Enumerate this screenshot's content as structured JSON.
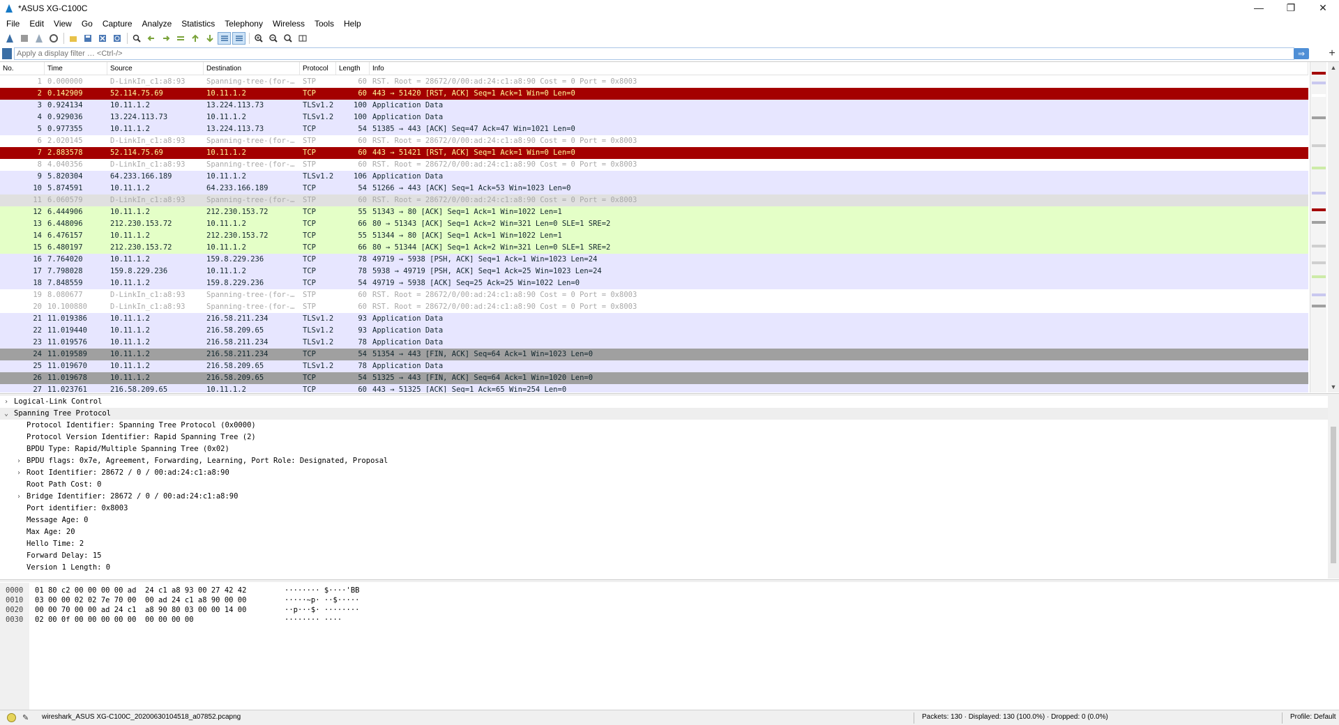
{
  "window": {
    "title": "*ASUS XG-C100C",
    "controls": {
      "minimize": "—",
      "maximize": "❐",
      "close": "✕"
    }
  },
  "menu": [
    "File",
    "Edit",
    "View",
    "Go",
    "Capture",
    "Analyze",
    "Statistics",
    "Telephony",
    "Wireless",
    "Tools",
    "Help"
  ],
  "filter": {
    "placeholder": "Apply a display filter … <Ctrl-/>",
    "value": ""
  },
  "columns": [
    "No.",
    "Time",
    "Source",
    "Destination",
    "Protocol",
    "Length",
    "Info"
  ],
  "packets": [
    {
      "no": "1",
      "time": "0.000000",
      "src": "D-LinkIn_c1:a8:93",
      "dst": "Spanning-tree-(for-…",
      "proto": "STP",
      "len": "60",
      "info": "RST. Root = 28672/0/00:ad:24:c1:a8:90  Cost = 0  Port = 0x8003",
      "style": "stp"
    },
    {
      "no": "2",
      "time": "0.142909",
      "src": "52.114.75.69",
      "dst": "10.11.1.2",
      "proto": "TCP",
      "len": "60",
      "info": "443 → 51420 [RST, ACK] Seq=1 Ack=1 Win=0 Len=0",
      "style": "rst"
    },
    {
      "no": "3",
      "time": "0.924134",
      "src": "10.11.1.2",
      "dst": "13.224.113.73",
      "proto": "TLSv1.2",
      "len": "100",
      "info": "Application Data",
      "style": "tls"
    },
    {
      "no": "4",
      "time": "0.929036",
      "src": "13.224.113.73",
      "dst": "10.11.1.2",
      "proto": "TLSv1.2",
      "len": "100",
      "info": "Application Data",
      "style": "tls"
    },
    {
      "no": "5",
      "time": "0.977355",
      "src": "10.11.1.2",
      "dst": "13.224.113.73",
      "proto": "TCP",
      "len": "54",
      "info": "51385 → 443 [ACK] Seq=47 Ack=47 Win=1021 Len=0",
      "style": "tcp"
    },
    {
      "no": "6",
      "time": "2.020145",
      "src": "D-LinkIn_c1:a8:93",
      "dst": "Spanning-tree-(for-…",
      "proto": "STP",
      "len": "60",
      "info": "RST. Root = 28672/0/00:ad:24:c1:a8:90  Cost = 0  Port = 0x8003",
      "style": "stp"
    },
    {
      "no": "7",
      "time": "2.883578",
      "src": "52.114.75.69",
      "dst": "10.11.1.2",
      "proto": "TCP",
      "len": "60",
      "info": "443 → 51421 [RST, ACK] Seq=1 Ack=1 Win=0 Len=0",
      "style": "rst"
    },
    {
      "no": "8",
      "time": "4.040356",
      "src": "D-LinkIn_c1:a8:93",
      "dst": "Spanning-tree-(for-…",
      "proto": "STP",
      "len": "60",
      "info": "RST. Root = 28672/0/00:ad:24:c1:a8:90  Cost = 0  Port = 0x8003",
      "style": "stp"
    },
    {
      "no": "9",
      "time": "5.820304",
      "src": "64.233.166.189",
      "dst": "10.11.1.2",
      "proto": "TLSv1.2",
      "len": "106",
      "info": "Application Data",
      "style": "tls"
    },
    {
      "no": "10",
      "time": "5.874591",
      "src": "10.11.1.2",
      "dst": "64.233.166.189",
      "proto": "TCP",
      "len": "54",
      "info": "51266 → 443 [ACK] Seq=1 Ack=53 Win=1023 Len=0",
      "style": "tcp"
    },
    {
      "no": "11",
      "time": "6.060579",
      "src": "D-LinkIn_c1:a8:93",
      "dst": "Spanning-tree-(for-…",
      "proto": "STP",
      "len": "60",
      "info": "RST. Root = 28672/0/00:ad:24:c1:a8:90  Cost = 0  Port = 0x8003",
      "style": "gray"
    },
    {
      "no": "12",
      "time": "6.444906",
      "src": "10.11.1.2",
      "dst": "212.230.153.72",
      "proto": "TCP",
      "len": "55",
      "info": "51343 → 80 [ACK] Seq=1 Ack=1 Win=1022 Len=1",
      "style": "green"
    },
    {
      "no": "13",
      "time": "6.448096",
      "src": "212.230.153.72",
      "dst": "10.11.1.2",
      "proto": "TCP",
      "len": "66",
      "info": "80 → 51343 [ACK] Seq=1 Ack=2 Win=321 Len=0 SLE=1 SRE=2",
      "style": "green"
    },
    {
      "no": "14",
      "time": "6.476157",
      "src": "10.11.1.2",
      "dst": "212.230.153.72",
      "proto": "TCP",
      "len": "55",
      "info": "51344 → 80 [ACK] Seq=1 Ack=1 Win=1022 Len=1",
      "style": "green"
    },
    {
      "no": "15",
      "time": "6.480197",
      "src": "212.230.153.72",
      "dst": "10.11.1.2",
      "proto": "TCP",
      "len": "66",
      "info": "80 → 51344 [ACK] Seq=1 Ack=2 Win=321 Len=0 SLE=1 SRE=2",
      "style": "green"
    },
    {
      "no": "16",
      "time": "7.764020",
      "src": "10.11.1.2",
      "dst": "159.8.229.236",
      "proto": "TCP",
      "len": "78",
      "info": "49719 → 5938 [PSH, ACK] Seq=1 Ack=1 Win=1023 Len=24",
      "style": "tcp"
    },
    {
      "no": "17",
      "time": "7.798028",
      "src": "159.8.229.236",
      "dst": "10.11.1.2",
      "proto": "TCP",
      "len": "78",
      "info": "5938 → 49719 [PSH, ACK] Seq=1 Ack=25 Win=1023 Len=24",
      "style": "tcp"
    },
    {
      "no": "18",
      "time": "7.848559",
      "src": "10.11.1.2",
      "dst": "159.8.229.236",
      "proto": "TCP",
      "len": "54",
      "info": "49719 → 5938 [ACK] Seq=25 Ack=25 Win=1022 Len=0",
      "style": "tcp"
    },
    {
      "no": "19",
      "time": "8.080677",
      "src": "D-LinkIn_c1:a8:93",
      "dst": "Spanning-tree-(for-…",
      "proto": "STP",
      "len": "60",
      "info": "RST. Root = 28672/0/00:ad:24:c1:a8:90  Cost = 0  Port = 0x8003",
      "style": "stp"
    },
    {
      "no": "20",
      "time": "10.100880",
      "src": "D-LinkIn_c1:a8:93",
      "dst": "Spanning-tree-(for-…",
      "proto": "STP",
      "len": "60",
      "info": "RST. Root = 28672/0/00:ad:24:c1:a8:90  Cost = 0  Port = 0x8003",
      "style": "stp"
    },
    {
      "no": "21",
      "time": "11.019386",
      "src": "10.11.1.2",
      "dst": "216.58.211.234",
      "proto": "TLSv1.2",
      "len": "93",
      "info": "Application Data",
      "style": "tls"
    },
    {
      "no": "22",
      "time": "11.019440",
      "src": "10.11.1.2",
      "dst": "216.58.209.65",
      "proto": "TLSv1.2",
      "len": "93",
      "info": "Application Data",
      "style": "tls"
    },
    {
      "no": "23",
      "time": "11.019576",
      "src": "10.11.1.2",
      "dst": "216.58.211.234",
      "proto": "TLSv1.2",
      "len": "78",
      "info": "Application Data",
      "style": "tls"
    },
    {
      "no": "24",
      "time": "11.019589",
      "src": "10.11.1.2",
      "dst": "216.58.211.234",
      "proto": "TCP",
      "len": "54",
      "info": "51354 → 443 [FIN, ACK] Seq=64 Ack=1 Win=1023 Len=0",
      "style": "fin"
    },
    {
      "no": "25",
      "time": "11.019670",
      "src": "10.11.1.2",
      "dst": "216.58.209.65",
      "proto": "TLSv1.2",
      "len": "78",
      "info": "Application Data",
      "style": "tls"
    },
    {
      "no": "26",
      "time": "11.019678",
      "src": "10.11.1.2",
      "dst": "216.58.209.65",
      "proto": "TCP",
      "len": "54",
      "info": "51325 → 443 [FIN, ACK] Seq=64 Ack=1 Win=1020 Len=0",
      "style": "fin"
    },
    {
      "no": "27",
      "time": "11.023761",
      "src": "216.58.209.65",
      "dst": "10.11.1.2",
      "proto": "TCP",
      "len": "60",
      "info": "443 → 51325 [ACK] Seq=1 Ack=65 Win=254 Len=0",
      "style": "tcp"
    }
  ],
  "details": [
    {
      "text": "Logical-Link Control",
      "level": 0,
      "twisty": "›"
    },
    {
      "text": "Spanning Tree Protocol",
      "level": 0,
      "twisty": "⌄",
      "selected": true
    },
    {
      "text": "Protocol Identifier: Spanning Tree Protocol (0x0000)",
      "level": 1,
      "twisty": ""
    },
    {
      "text": "Protocol Version Identifier: Rapid Spanning Tree (2)",
      "level": 1,
      "twisty": ""
    },
    {
      "text": "BPDU Type: Rapid/Multiple Spanning Tree (0x02)",
      "level": 1,
      "twisty": ""
    },
    {
      "text": "BPDU flags: 0x7e, Agreement, Forwarding, Learning, Port Role: Designated, Proposal",
      "level": 1,
      "twisty": "›"
    },
    {
      "text": "Root Identifier: 28672 / 0 / 00:ad:24:c1:a8:90",
      "level": 1,
      "twisty": "›"
    },
    {
      "text": "Root Path Cost: 0",
      "level": 1,
      "twisty": ""
    },
    {
      "text": "Bridge Identifier: 28672 / 0 / 00:ad:24:c1:a8:90",
      "level": 1,
      "twisty": "›"
    },
    {
      "text": "Port identifier: 0x8003",
      "level": 1,
      "twisty": ""
    },
    {
      "text": "Message Age: 0",
      "level": 1,
      "twisty": ""
    },
    {
      "text": "Max Age: 20",
      "level": 1,
      "twisty": ""
    },
    {
      "text": "Hello Time: 2",
      "level": 1,
      "twisty": ""
    },
    {
      "text": "Forward Delay: 15",
      "level": 1,
      "twisty": ""
    },
    {
      "text": "Version 1 Length: 0",
      "level": 1,
      "twisty": ""
    }
  ],
  "hex": [
    {
      "offset": "0000",
      "bytes": "01 80 c2 00 00 00 00 ad  24 c1 a8 93 00 27 42 42",
      "ascii": "········ $····'BB"
    },
    {
      "offset": "0010",
      "bytes": "03 00 00 02 02 7e 70 00  00 ad 24 c1 a8 90 00 00",
      "ascii": "·····~p· ··$·····"
    },
    {
      "offset": "0020",
      "bytes": "00 00 70 00 00 ad 24 c1  a8 90 80 03 00 00 14 00",
      "ascii": "··p···$· ········"
    },
    {
      "offset": "0030",
      "bytes": "02 00 0f 00 00 00 00 00  00 00 00 00",
      "ascii": "········ ····"
    }
  ],
  "status": {
    "file": "wireshark_ASUS XG-C100C_20200630104518_a07852.pcapng",
    "packets": "Packets: 130 · Displayed: 130 (100.0%) · Dropped: 0 (0.0%)",
    "profile": "Profile: Default"
  },
  "colors": {
    "rst_bg": "#a40000",
    "rst_fg": "#fffc9c",
    "tcp_bg": "#e7e6ff",
    "http_bg": "#e4ffc7",
    "fin_bg": "#a0a0a0",
    "stp_fg": "#a8a8a8"
  },
  "toolbar_icons": [
    "shark-fin-start-icon",
    "stop-icon",
    "restart-icon",
    "options-gear-icon",
    "open-folder-icon",
    "save-icon",
    "close-file-icon",
    "reload-icon",
    "find-icon",
    "go-back-icon",
    "go-forward-icon",
    "go-to-packet-icon",
    "go-first-icon",
    "go-last-icon",
    "autoscroll-icon",
    "colorize-icon",
    "zoom-in-icon",
    "zoom-out-icon",
    "zoom-normal-icon",
    "resize-columns-icon"
  ]
}
